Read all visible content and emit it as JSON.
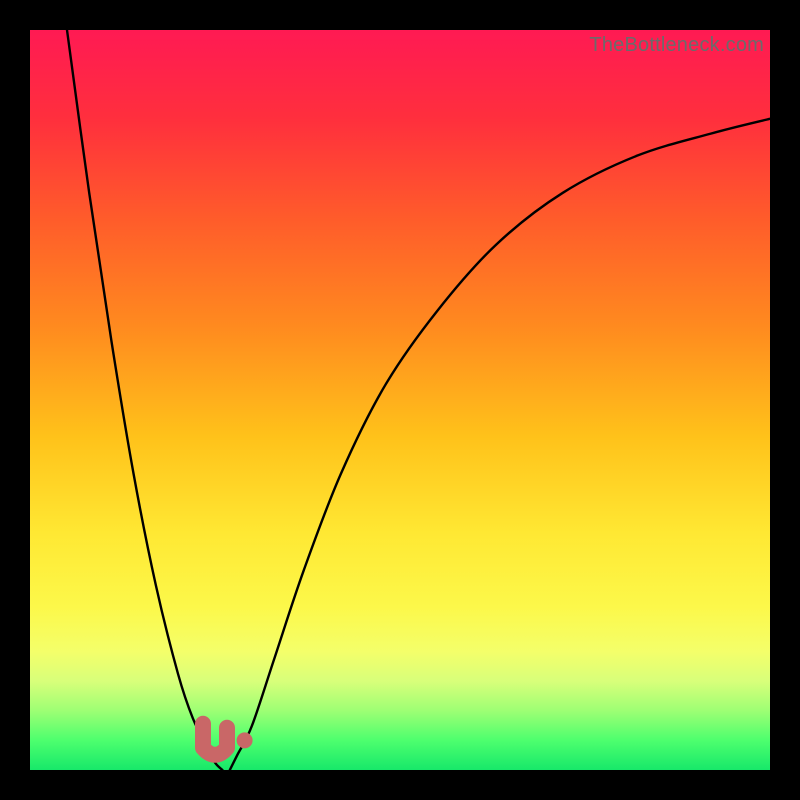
{
  "watermark": "TheBottleneck.com",
  "chart_data": {
    "type": "line",
    "title": "",
    "xlabel": "",
    "ylabel": "",
    "xlim": [
      0,
      100
    ],
    "ylim": [
      0,
      100
    ],
    "grid": false,
    "legend": false,
    "series": [
      {
        "name": "left-curve",
        "x": [
          5,
          8,
          11,
          14,
          17,
          20,
          22,
          24,
          25,
          26
        ],
        "values": [
          100,
          78,
          58,
          40,
          25,
          13,
          7,
          3,
          1,
          0
        ]
      },
      {
        "name": "right-curve",
        "x": [
          27,
          28,
          30,
          33,
          37,
          42,
          48,
          55,
          63,
          72,
          82,
          92,
          100
        ],
        "values": [
          0,
          2,
          6,
          15,
          27,
          40,
          52,
          62,
          71,
          78,
          83,
          86,
          88
        ]
      }
    ],
    "markers": [
      {
        "name": "u-blob",
        "x": 25,
        "y": 3,
        "shape": "u",
        "color": "#c96767"
      },
      {
        "name": "dot",
        "x": 29,
        "y": 4,
        "shape": "circle",
        "color": "#c96767"
      }
    ],
    "gradient_stops": [
      {
        "pos": 0.0,
        "color": "#ff1a53"
      },
      {
        "pos": 0.12,
        "color": "#ff2f3d"
      },
      {
        "pos": 0.25,
        "color": "#ff5a2b"
      },
      {
        "pos": 0.4,
        "color": "#ff8a1f"
      },
      {
        "pos": 0.55,
        "color": "#ffc21a"
      },
      {
        "pos": 0.68,
        "color": "#ffe833"
      },
      {
        "pos": 0.78,
        "color": "#fcf84a"
      },
      {
        "pos": 0.84,
        "color": "#f4ff6a"
      },
      {
        "pos": 0.88,
        "color": "#d8ff7a"
      },
      {
        "pos": 0.92,
        "color": "#9dff74"
      },
      {
        "pos": 0.96,
        "color": "#4dff6e"
      },
      {
        "pos": 1.0,
        "color": "#17e86a"
      }
    ]
  }
}
